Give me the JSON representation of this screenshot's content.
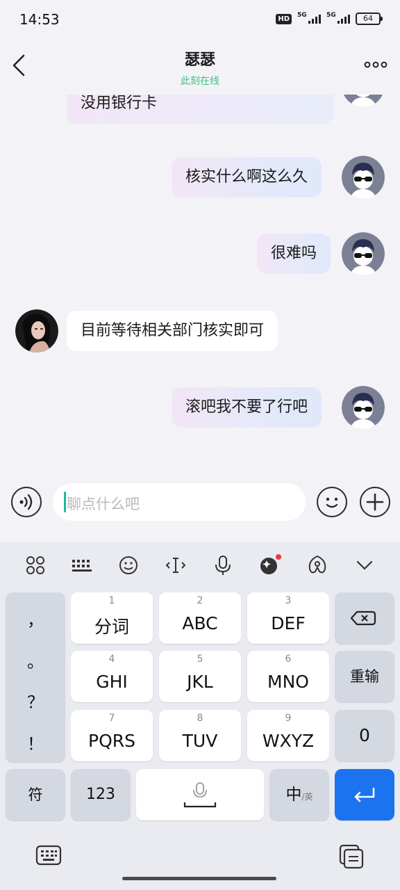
{
  "status": {
    "time": "14:53",
    "hd": "HD",
    "net1": "5G",
    "net2": "5G",
    "battery": "64"
  },
  "header": {
    "title": "瑟瑟",
    "subtitle": "此刻在线"
  },
  "messages": [
    {
      "side": "out",
      "text": "没用银行卡",
      "partial": true
    },
    {
      "side": "out",
      "text": "核实什么啊这么久"
    },
    {
      "side": "out",
      "text": "很难吗"
    },
    {
      "side": "in",
      "text": "目前等待相关部门核实即可"
    },
    {
      "side": "out",
      "text": "滚吧我不要了行吧"
    }
  ],
  "input": {
    "placeholder": "聊点什么吧"
  },
  "keyboard": {
    "toolbar_icons": [
      "grid-icon",
      "keyboard-icon",
      "emoji-icon",
      "cursor-icon",
      "mic-icon",
      "ai-skin-icon",
      "handwriting-icon",
      "collapse-icon"
    ],
    "punctuation": [
      "，",
      "。",
      "？",
      "！"
    ],
    "keys": [
      {
        "num": "1",
        "label": "分词"
      },
      {
        "num": "2",
        "label": "ABC"
      },
      {
        "num": "3",
        "label": "DEF"
      },
      {
        "num": "4",
        "label": "GHI"
      },
      {
        "num": "5",
        "label": "JKL"
      },
      {
        "num": "6",
        "label": "MNO"
      },
      {
        "num": "7",
        "label": "PQRS"
      },
      {
        "num": "8",
        "label": "TUV"
      },
      {
        "num": "9",
        "label": "WXYZ"
      }
    ],
    "reenter": "重输",
    "zero": "0",
    "symbol": "符",
    "numeric": "123",
    "lang_main": "中",
    "lang_sub": "/英"
  },
  "colors": {
    "accent": "#1b73f0",
    "online": "#3bbf7a",
    "caret": "#1fb6a4"
  }
}
